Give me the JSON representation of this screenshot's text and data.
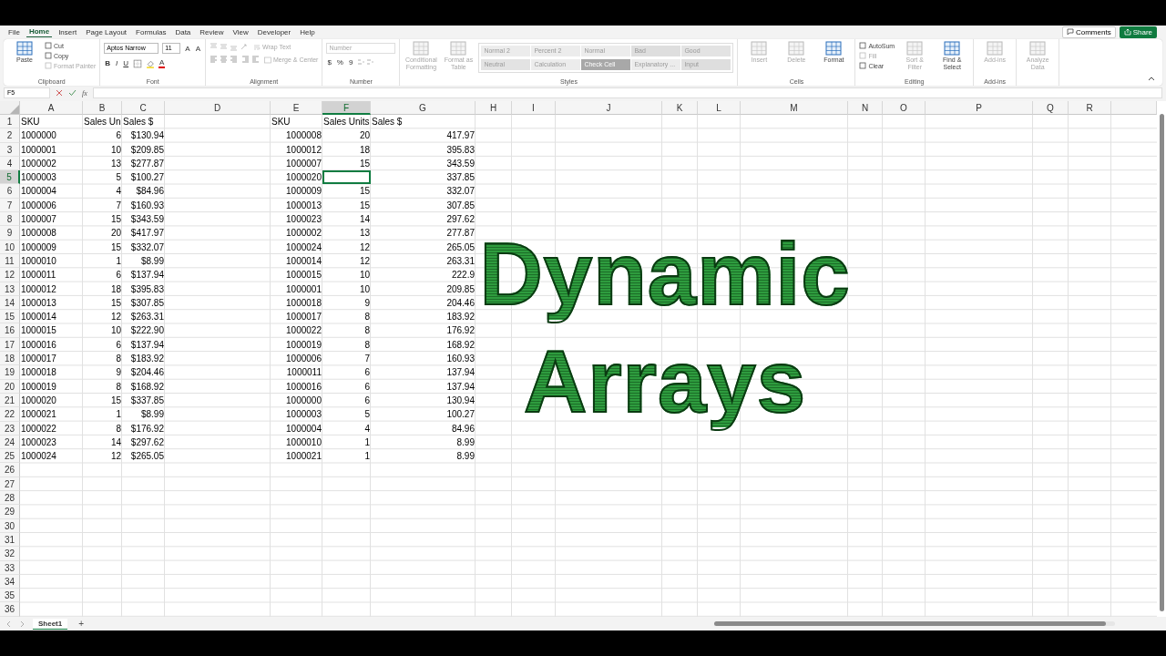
{
  "menu_tabs": [
    {
      "label": "File",
      "selected": false
    },
    {
      "label": "Home",
      "selected": true
    },
    {
      "label": "Insert",
      "selected": false
    },
    {
      "label": "Page Layout",
      "selected": false
    },
    {
      "label": "Formulas",
      "selected": false
    },
    {
      "label": "Data",
      "selected": false
    },
    {
      "label": "Review",
      "selected": false
    },
    {
      "label": "View",
      "selected": false
    },
    {
      "label": "Developer",
      "selected": false
    },
    {
      "label": "Help",
      "selected": false
    }
  ],
  "comments_button": "Comments",
  "share_button": "Share",
  "ribbon": {
    "groups": [
      {
        "kind": "generic",
        "label": "Clipboard",
        "items": [
          {
            "label": "Paste",
            "kind": "large",
            "disabled": false
          },
          {
            "label": "Cut",
            "kind": "small",
            "disabled": false
          },
          {
            "label": "Copy",
            "kind": "small",
            "disabled": false
          },
          {
            "label": "Format Painter",
            "kind": "small",
            "disabled": true
          }
        ]
      },
      {
        "kind": "font",
        "label": "Font",
        "font_name": "Aptos Narrow",
        "font_size": "11",
        "grow": "A",
        "shrink": "A",
        "format_buttons": [
          "B",
          "I",
          "U"
        ],
        "font_color": "A"
      },
      {
        "kind": "alignment",
        "label": "Alignment",
        "wrap_text": {
          "label": "Wrap Text",
          "disabled": true
        },
        "merge": {
          "label": "Merge & Center",
          "disabled": true
        }
      },
      {
        "kind": "number",
        "label": "Number",
        "format": {
          "value": "Number",
          "disabled": true
        },
        "symbols": [
          "$",
          "%",
          "9"
        ]
      },
      {
        "kind": "styles",
        "label": "Styles",
        "items": [
          {
            "label": "Conditional Formatting",
            "kind": "large",
            "disabled": true
          },
          {
            "label": "Format as Table",
            "kind": "large",
            "disabled": true
          }
        ],
        "cell_styles": [
          {
            "label": "Normal 2",
            "color": "#ececec"
          },
          {
            "label": "Percent 2",
            "color": "#ececec"
          },
          {
            "label": "Normal",
            "color": "#ececec"
          },
          {
            "label": "Bad",
            "color": "#dedede"
          },
          {
            "label": "Good",
            "color": "#e3e3e3"
          },
          {
            "label": "Neutral",
            "color": "#e3e3e3"
          },
          {
            "label": "Calculation",
            "color": "#ececec"
          },
          {
            "label": "Check Cell",
            "color": "#a8a8a8"
          },
          {
            "label": "Explanatory ...",
            "color": "#ececec"
          },
          {
            "label": "Input",
            "color": "#dedede"
          }
        ]
      },
      {
        "kind": "generic",
        "label": "Cells",
        "items": [
          {
            "label": "Insert",
            "kind": "large",
            "disabled": true
          },
          {
            "label": "Delete",
            "kind": "large",
            "disabled": true
          },
          {
            "label": "Format",
            "kind": "large",
            "disabled": false
          }
        ]
      },
      {
        "kind": "generic",
        "label": "Editing",
        "items": [
          {
            "label": "AutoSum",
            "kind": "small",
            "disabled": false
          },
          {
            "label": "Fill",
            "kind": "small",
            "disabled": true
          },
          {
            "label": "Clear",
            "kind": "small",
            "disabled": false
          },
          {
            "label": "Sort & Filter",
            "kind": "large",
            "disabled": true
          },
          {
            "label": "Find & Select",
            "kind": "large",
            "disabled": false
          }
        ]
      },
      {
        "kind": "generic",
        "label": "Add-ins",
        "items": [
          {
            "label": "Add-ins",
            "kind": "large",
            "disabled": true
          }
        ]
      },
      {
        "kind": "generic",
        "items": [
          {
            "label": "Analyze Data",
            "kind": "large",
            "disabled": true
          }
        ]
      }
    ]
  },
  "name_box": "F5",
  "fx": "fx",
  "columns": [
    {
      "label": "A",
      "selected": false,
      "kind": "text"
    },
    {
      "label": "B",
      "selected": false,
      "kind": "number"
    },
    {
      "label": "C",
      "selected": false,
      "kind": "number"
    },
    {
      "label": "D",
      "selected": false
    },
    {
      "label": "E",
      "selected": false,
      "kind": "number"
    },
    {
      "label": "F",
      "selected": true,
      "kind": "number"
    },
    {
      "label": "G",
      "selected": false,
      "kind": "number"
    },
    {
      "label": "H",
      "selected": false
    },
    {
      "label": "I",
      "selected": false
    },
    {
      "label": "J",
      "selected": false
    },
    {
      "label": "K",
      "selected": false
    },
    {
      "label": "L",
      "selected": false
    },
    {
      "label": "M",
      "selected": false
    },
    {
      "label": "N",
      "selected": false
    },
    {
      "label": "O",
      "selected": false
    },
    {
      "label": "P",
      "selected": false
    },
    {
      "label": "Q",
      "selected": false
    },
    {
      "label": "R",
      "selected": false
    }
  ],
  "rows": [
    {
      "label": "1",
      "selected": false,
      "kind": "header",
      "cells": [
        "SKU",
        "Sales Un",
        "Sales $",
        null,
        "SKU",
        "Sales Units",
        "Sales $"
      ]
    },
    {
      "label": "2",
      "selected": false,
      "kind": "data",
      "cells": [
        "1000000",
        "6",
        "$130.94",
        null,
        "1000008",
        "20",
        "417.97"
      ]
    },
    {
      "label": "3",
      "selected": false,
      "kind": "data",
      "cells": [
        "1000001",
        "10",
        "$209.85",
        null,
        "1000012",
        "18",
        "395.83"
      ]
    },
    {
      "label": "4",
      "selected": false,
      "kind": "data",
      "cells": [
        "1000002",
        "13",
        "$277.87",
        null,
        "1000007",
        "15",
        "343.59"
      ]
    },
    {
      "label": "5",
      "selected": true,
      "kind": "data",
      "cells": [
        "1000003",
        "5",
        "$100.27",
        null,
        "1000020",
        null,
        "337.85"
      ]
    },
    {
      "label": "6",
      "selected": false,
      "kind": "data",
      "cells": [
        "1000004",
        "4",
        "$84.96",
        null,
        "1000009",
        "15",
        "332.07"
      ]
    },
    {
      "label": "7",
      "selected": false,
      "kind": "data",
      "cells": [
        "1000006",
        "7",
        "$160.93",
        null,
        "1000013",
        "15",
        "307.85"
      ]
    },
    {
      "label": "8",
      "selected": false,
      "kind": "data",
      "cells": [
        "1000007",
        "15",
        "$343.59",
        null,
        "1000023",
        "14",
        "297.62"
      ]
    },
    {
      "label": "9",
      "selected": false,
      "kind": "data",
      "cells": [
        "1000008",
        "20",
        "$417.97",
        null,
        "1000002",
        "13",
        "277.87"
      ]
    },
    {
      "label": "10",
      "selected": false,
      "kind": "data",
      "cells": [
        "1000009",
        "15",
        "$332.07",
        null,
        "1000024",
        "12",
        "265.05"
      ]
    },
    {
      "label": "11",
      "selected": false,
      "kind": "data",
      "cells": [
        "1000010",
        "1",
        "$8.99",
        null,
        "1000014",
        "12",
        "263.31"
      ]
    },
    {
      "label": "12",
      "selected": false,
      "kind": "data",
      "cells": [
        "1000011",
        "6",
        "$137.94",
        null,
        "1000015",
        "10",
        "222.9"
      ]
    },
    {
      "label": "13",
      "selected": false,
      "kind": "data",
      "cells": [
        "1000012",
        "18",
        "$395.83",
        null,
        "1000001",
        "10",
        "209.85"
      ]
    },
    {
      "label": "14",
      "selected": false,
      "kind": "data",
      "cells": [
        "1000013",
        "15",
        "$307.85",
        null,
        "1000018",
        "9",
        "204.46"
      ]
    },
    {
      "label": "15",
      "selected": false,
      "kind": "data",
      "cells": [
        "1000014",
        "12",
        "$263.31",
        null,
        "1000017",
        "8",
        "183.92"
      ]
    },
    {
      "label": "16",
      "selected": false,
      "kind": "data",
      "cells": [
        "1000015",
        "10",
        "$222.90",
        null,
        "1000022",
        "8",
        "176.92"
      ]
    },
    {
      "label": "17",
      "selected": false,
      "kind": "data",
      "cells": [
        "1000016",
        "6",
        "$137.94",
        null,
        "1000019",
        "8",
        "168.92"
      ]
    },
    {
      "label": "18",
      "selected": false,
      "kind": "data",
      "cells": [
        "1000017",
        "8",
        "$183.92",
        null,
        "1000006",
        "7",
        "160.93"
      ]
    },
    {
      "label": "19",
      "selected": false,
      "kind": "data",
      "cells": [
        "1000018",
        "9",
        "$204.46",
        null,
        "1000011",
        "6",
        "137.94"
      ]
    },
    {
      "label": "20",
      "selected": false,
      "kind": "data",
      "cells": [
        "1000019",
        "8",
        "$168.92",
        null,
        "1000016",
        "6",
        "137.94"
      ]
    },
    {
      "label": "21",
      "selected": false,
      "kind": "data",
      "cells": [
        "1000020",
        "15",
        "$337.85",
        null,
        "1000000",
        "6",
        "130.94"
      ]
    },
    {
      "label": "22",
      "selected": false,
      "kind": "data",
      "cells": [
        "1000021",
        "1",
        "$8.99",
        null,
        "1000003",
        "5",
        "100.27"
      ]
    },
    {
      "label": "23",
      "selected": false,
      "kind": "data",
      "cells": [
        "1000022",
        "8",
        "$176.92",
        null,
        "1000004",
        "4",
        "84.96"
      ]
    },
    {
      "label": "24",
      "selected": false,
      "kind": "data",
      "cells": [
        "1000023",
        "14",
        "$297.62",
        null,
        "1000010",
        "1",
        "8.99"
      ]
    },
    {
      "label": "25",
      "selected": false,
      "kind": "data",
      "cells": [
        "1000024",
        "12",
        "$265.05",
        null,
        "1000021",
        "1",
        "8.99"
      ]
    },
    {
      "label": "26",
      "selected": false,
      "kind": "data"
    },
    {
      "label": "27",
      "selected": false,
      "kind": "data"
    },
    {
      "label": "28",
      "selected": false,
      "kind": "data"
    },
    {
      "label": "29",
      "selected": false,
      "kind": "data"
    },
    {
      "label": "30",
      "selected": false,
      "kind": "data"
    },
    {
      "label": "31",
      "selected": false,
      "kind": "data"
    },
    {
      "label": "32",
      "selected": false,
      "kind": "data"
    },
    {
      "label": "33",
      "selected": false,
      "kind": "data"
    },
    {
      "label": "34",
      "selected": false,
      "kind": "data"
    },
    {
      "label": "35",
      "selected": false,
      "kind": "data"
    },
    {
      "label": "36",
      "selected": false,
      "kind": "data"
    }
  ],
  "overlay_title": [
    "Dynamic",
    "Arrays"
  ],
  "sheet_tabs": [
    {
      "label": "Sheet1",
      "selected": true
    }
  ],
  "add_sheet": "+"
}
